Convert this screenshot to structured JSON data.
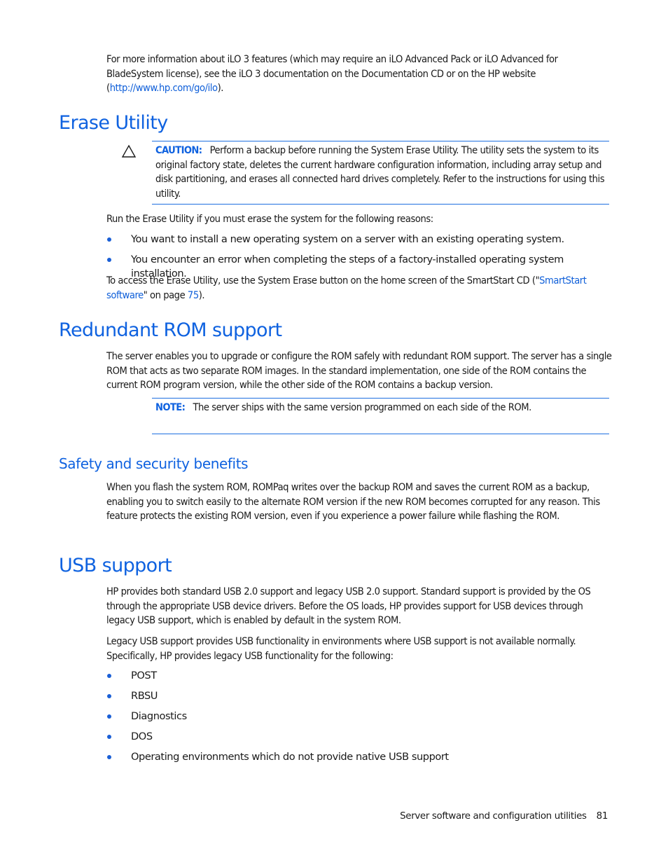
{
  "intro": {
    "text_before_link": "For more information about iLO 3 features (which may require an iLO Advanced Pack or iLO Advanced for BladeSystem license), see the iLO 3 documentation on the Documentation CD or on the HP website (",
    "link": "http://www.hp.com/go/ilo",
    "text_after_link": ")."
  },
  "erase_utility": {
    "heading": "Erase Utility",
    "caution": {
      "icon": "warning-triangle-icon",
      "label": "CAUTION:",
      "text": "Perform a backup before running the System Erase Utility. The utility sets the system to its original factory state, deletes the current hardware configuration information, including array setup and disk partitioning, and erases all connected hard drives completely. Refer to the instructions for using this utility."
    },
    "reasons_intro": "Run the Erase Utility if you must erase the system for the following reasons:",
    "reasons": [
      "You want to install a new operating system on a server with an existing operating system.",
      "You encounter an error when completing the steps of a factory-installed operating system installation."
    ],
    "access_text_before": "To access the Erase Utility, use the System Erase button on the home screen of the SmartStart CD (\"",
    "access_link": "SmartStart software",
    "access_text_middle": "\" on page ",
    "access_page_link": "75",
    "access_text_after": ")."
  },
  "redundant_rom": {
    "heading": "Redundant ROM support",
    "paragraph": "The server enables you to upgrade or configure the ROM safely with redundant ROM support. The server has a single ROM that acts as two separate ROM images. In the standard implementation, one side of the ROM contains the current ROM program version, while the other side of the ROM contains a backup version.",
    "note": {
      "label": "NOTE:",
      "text": "The server ships with the same version programmed on each side of the ROM."
    }
  },
  "safety": {
    "heading": "Safety and security benefits",
    "paragraph": "When you flash the system ROM, ROMPaq writes over the backup ROM and saves the current ROM as a backup, enabling you to switch easily to the alternate ROM version if the new ROM becomes corrupted for any reason. This feature protects the existing ROM version, even if you experience a power failure while flashing the ROM."
  },
  "usb": {
    "heading": "USB support",
    "paragraph1": "HP provides both standard USB 2.0 support and legacy USB 2.0 support. Standard support is provided by the OS through the appropriate USB device drivers. Before the OS loads, HP provides support for USB devices through legacy USB support, which is enabled by default in the system ROM.",
    "paragraph2": "Legacy USB support provides USB functionality in environments where USB support is not available normally. Specifically, HP provides legacy USB functionality for the following:",
    "items": [
      "POST",
      "RBSU",
      "Diagnostics",
      "DOS",
      "Operating environments which do not provide native USB support"
    ]
  },
  "footer": {
    "chapter": "Server software and configuration utilities",
    "page_number": "81"
  },
  "colors": {
    "heading_blue": "#0f62e0",
    "link_blue": "#0f5fd9",
    "rule_blue": "#1e6fe0",
    "body_text": "#1a1a1a"
  }
}
